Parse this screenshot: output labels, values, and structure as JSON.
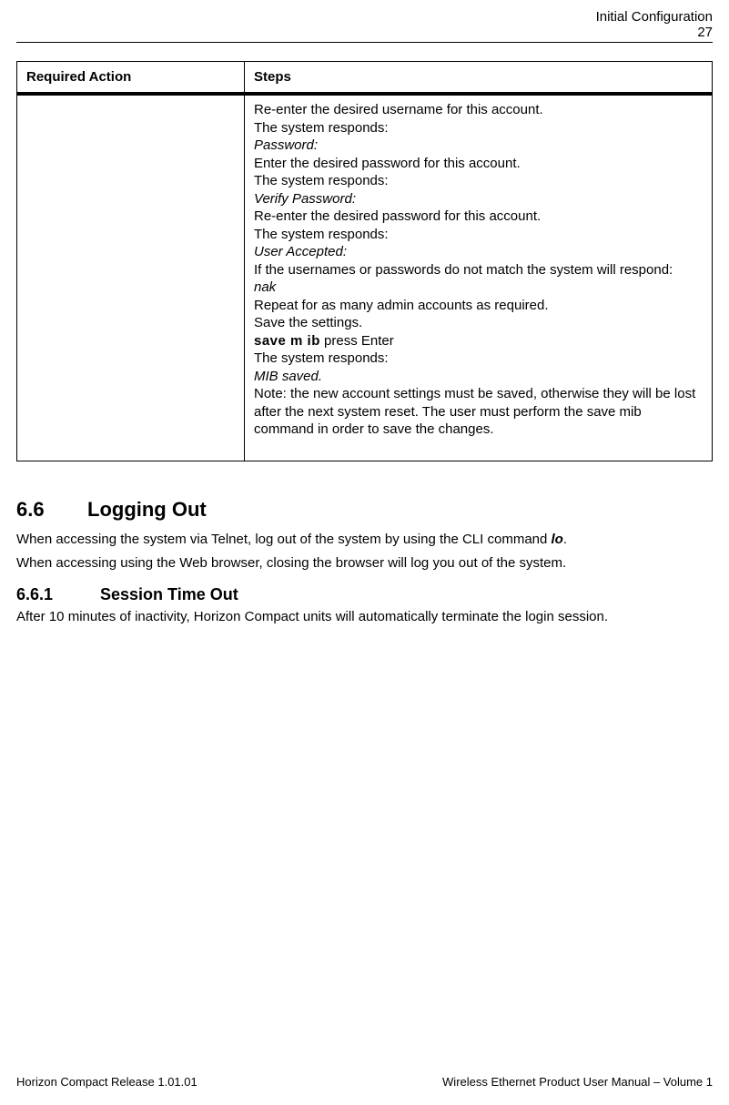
{
  "header": {
    "title": "Initial Configuration",
    "page": "27"
  },
  "table": {
    "col1": "Required Action",
    "col2": "Steps"
  },
  "steps": {
    "l1": "Re-enter the desired username for this account.",
    "l2": "The system responds:",
    "l3": "Password:",
    "l4": "Enter the desired password for this account.",
    "l5": "The system responds:",
    "l6": "Verify Password:",
    "l7": "Re-enter the desired password for this account.",
    "l8": "The system responds:",
    "l9": "User Accepted:",
    "l10": "If the usernames or passwords do not match the system will respond:",
    "l11": "nak",
    "l12": "Repeat for as many admin accounts as required.",
    "l13": "Save the settings.",
    "l14a": "save m ib",
    "l14b": " press Enter",
    "l15": "The system responds:",
    "l16": "MIB saved.",
    "l17": "Note: the new account settings must be saved, otherwise they will be lost after the next system reset. The user must perform the save mib command in order to save the changes."
  },
  "sec66": {
    "num": "6.6",
    "title": "Logging Out",
    "p1a": "When accessing the system via Telnet, log out of the system  by using the CLI command ",
    "p1b": "lo",
    "p1c": ".",
    "p2": "When accessing using the Web browser, closing the browser will log you out of the system."
  },
  "sec661": {
    "num": "6.6.1",
    "title": "Session Time Out",
    "p1": "After 10 minutes of inactivity, Horizon Compact units will automatically terminate the login session."
  },
  "footer": {
    "left": "Horizon Compact Release 1.01.01",
    "right": "Wireless Ethernet Product User Manual – Volume 1"
  }
}
